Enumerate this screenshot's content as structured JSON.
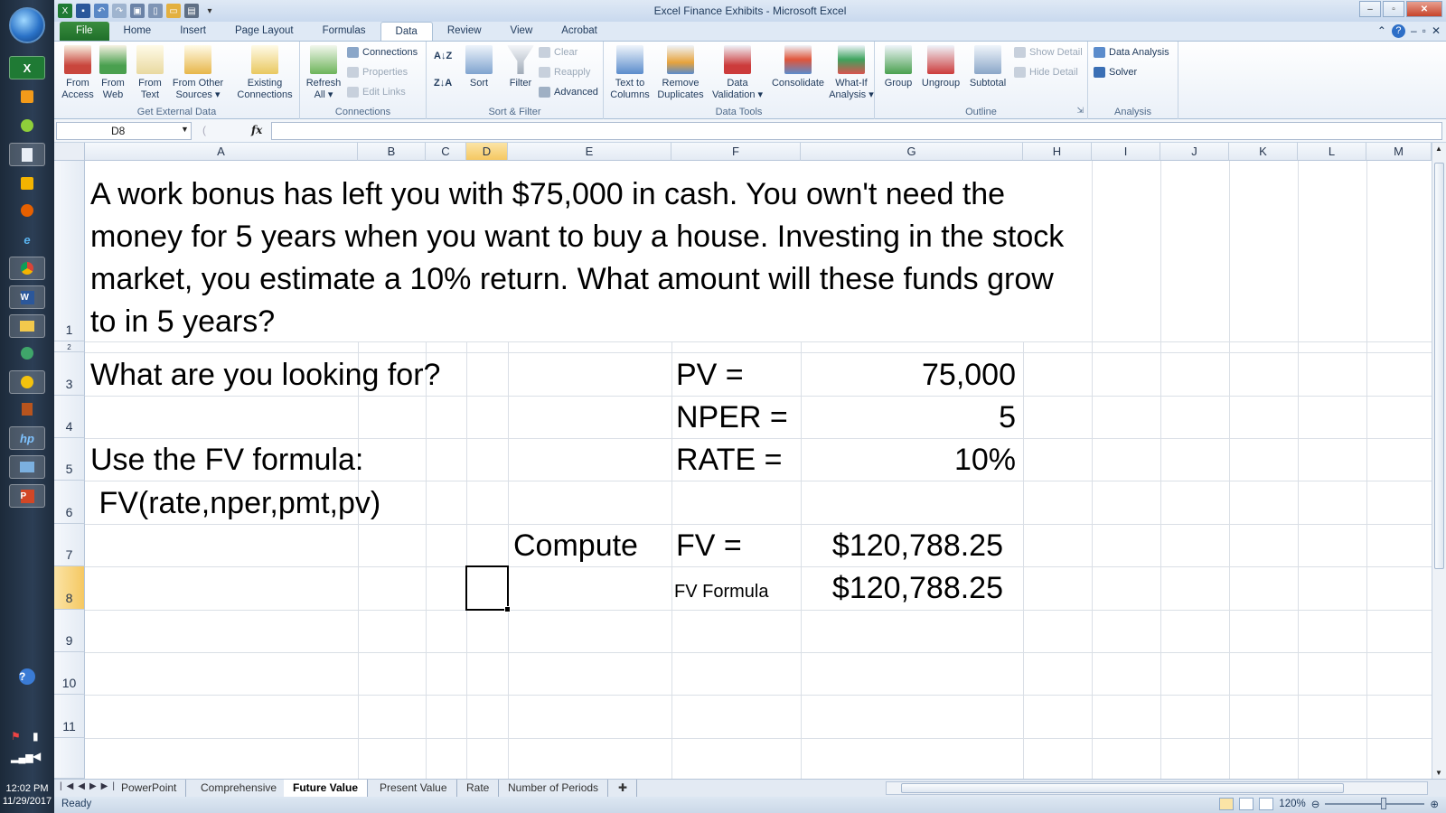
{
  "window": {
    "title": "Excel Finance Exhibits  -  Microsoft Excel"
  },
  "taskbar": {
    "clock_time": "12:02 PM",
    "clock_date": "11/29/2017",
    "icons": [
      "excel-icon",
      "media-player-icon",
      "green-circle-icon",
      "document-icon",
      "outlook-icon",
      "firefox-icon",
      "internet-explorer-icon",
      "chrome-icon",
      "word-icon",
      "file-explorer-icon",
      "app-icon",
      "norton-icon",
      "library-icon",
      "hp-icon",
      "remote-desktop-icon",
      "powerpoint-icon"
    ],
    "accent": "#1e2c3c"
  },
  "tabs": [
    "File",
    "Home",
    "Insert",
    "Page Layout",
    "Formulas",
    "Data",
    "Review",
    "View",
    "Acrobat"
  ],
  "active_tab": "Data",
  "ribbon": {
    "get_external": {
      "label": "Get External Data",
      "from_access_1": "From",
      "from_access_2": "Access",
      "from_web_1": "From",
      "from_web_2": "Web",
      "from_text_1": "From",
      "from_text_2": "Text",
      "from_other_1": "From Other",
      "from_other_2": "Sources ▾",
      "existing_1": "Existing",
      "existing_2": "Connections"
    },
    "connections": {
      "label": "Connections",
      "refresh_1": "Refresh",
      "refresh_2": "All ▾",
      "connections": "Connections",
      "properties": "Properties",
      "edit_links": "Edit Links"
    },
    "sort_filter": {
      "label": "Sort & Filter",
      "sort": "Sort",
      "filter": "Filter",
      "clear": "Clear",
      "reapply": "Reapply",
      "advanced": "Advanced"
    },
    "data_tools": {
      "label": "Data Tools",
      "text_cols_1": "Text to",
      "text_cols_2": "Columns",
      "remove_dup_1": "Remove",
      "remove_dup_2": "Duplicates",
      "validation_1": "Data",
      "validation_2": "Validation ▾",
      "consolidate": "Consolidate",
      "whatif_1": "What-If",
      "whatif_2": "Analysis ▾"
    },
    "outline": {
      "label": "Outline",
      "group": "Group",
      "ungroup": "Ungroup",
      "subtotal": "Subtotal",
      "show_detail": "Show Detail",
      "hide_detail": "Hide Detail"
    },
    "analysis": {
      "label": "Analysis",
      "data_analysis": "Data Analysis",
      "solver": "Solver"
    }
  },
  "formula_bar": {
    "name_box": "D8",
    "fx": "fx",
    "formula": ""
  },
  "columns": [
    "A",
    "B",
    "C",
    "D",
    "E",
    "F",
    "G",
    "H",
    "I",
    "J",
    "K",
    "L",
    "M"
  ],
  "rows": [
    "1",
    "2",
    "3",
    "4",
    "5",
    "6",
    "7",
    "8",
    "9",
    "10",
    "11"
  ],
  "cells": {
    "a1": "A work bonus has left you with $75,000 in cash.  You own't need the money for 5 years when you want to buy a house.  Investing in the stock market, you estimate a 10% return. What amount will these funds grow to in 5 years?",
    "a3": "What are you looking for?",
    "a5": "Use the FV formula:",
    "a6": " FV(rate,nper,pmt,pv)",
    "e7": "Compute",
    "f3": "PV =",
    "g3": "75,000",
    "f4": "NPER =",
    "g4": "5",
    "f5": "RATE =",
    "g5": "10%",
    "f7": "FV =",
    "g7": "$120,788.25",
    "f8": "FV Formula",
    "g8": "$120,788.25"
  },
  "sheets": [
    "PowerPoint",
    "Comprehensive",
    "Future Value",
    "Present Value",
    "Rate",
    "Number of Periods"
  ],
  "active_sheet": "Future Value",
  "status": {
    "text": "Ready",
    "zoom": "120%"
  }
}
